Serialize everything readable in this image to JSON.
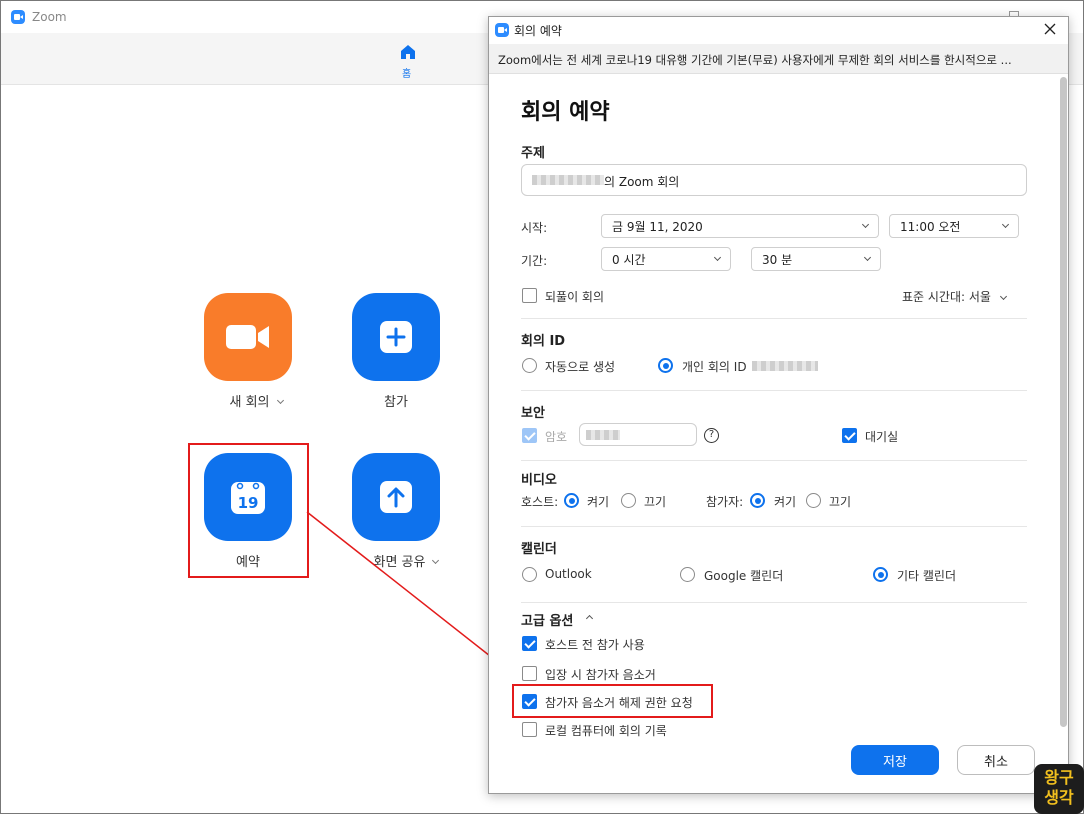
{
  "main_window": {
    "title": "Zoom",
    "toolbar": {
      "home_label": "홈"
    },
    "actions": {
      "new_meeting": "새 회의",
      "join": "참가",
      "schedule": "예약",
      "share_screen": "화면 공유",
      "calendar_day": "19"
    }
  },
  "dialog": {
    "window_title": "회의 예약",
    "banner": "Zoom에서는 전 세계 코로나19 대유행 기간에 기본(무료) 사용자에게 무제한 회의 서비스를 한시적으로 ...",
    "heading": "회의 예약",
    "topic": {
      "label": "주제",
      "value_suffix": "의 Zoom 회의"
    },
    "start": {
      "label": "시작:",
      "date": "금  9월  11,  2020",
      "time": "11:00  오전"
    },
    "duration": {
      "label": "기간:",
      "hours": "0 시간",
      "minutes": "30 분"
    },
    "recurring": {
      "label": "되풀이 회의",
      "checked": false
    },
    "timezone": "표준 시간대: 서울",
    "meeting_id": {
      "label": "회의 ID",
      "auto": "자동으로 생성",
      "personal": "개인 회의 ID",
      "selected": "personal"
    },
    "security": {
      "label": "보안",
      "password_label": "암호",
      "waiting_room": "대기실",
      "help_symbol": "?"
    },
    "video": {
      "label": "비디오",
      "host_label": "호스트:",
      "participant_label": "참가자:",
      "on": "켜기",
      "off": "끄기",
      "host": "on",
      "participant": "on"
    },
    "calendar": {
      "label": "캘린더",
      "outlook": "Outlook",
      "google": "Google 캘린더",
      "other": "기타 캘린더",
      "selected": "other"
    },
    "advanced": {
      "label": "고급 옵션",
      "options": [
        {
          "label": "호스트 전 참가 사용",
          "checked": true
        },
        {
          "label": "입장 시 참가자 음소거",
          "checked": false
        },
        {
          "label": "참가자 음소거 해제 권한 요청",
          "checked": true
        },
        {
          "label": "로컬 컴퓨터에 회의 기록",
          "checked": false
        }
      ]
    },
    "buttons": {
      "save": "저장",
      "cancel": "취소"
    }
  },
  "watermark": {
    "line1": "왕구",
    "line2": "생각"
  },
  "colors": {
    "zoom_blue": "#0e72ed",
    "orange": "#f97c2a",
    "highlight_red": "#e31b1b"
  }
}
